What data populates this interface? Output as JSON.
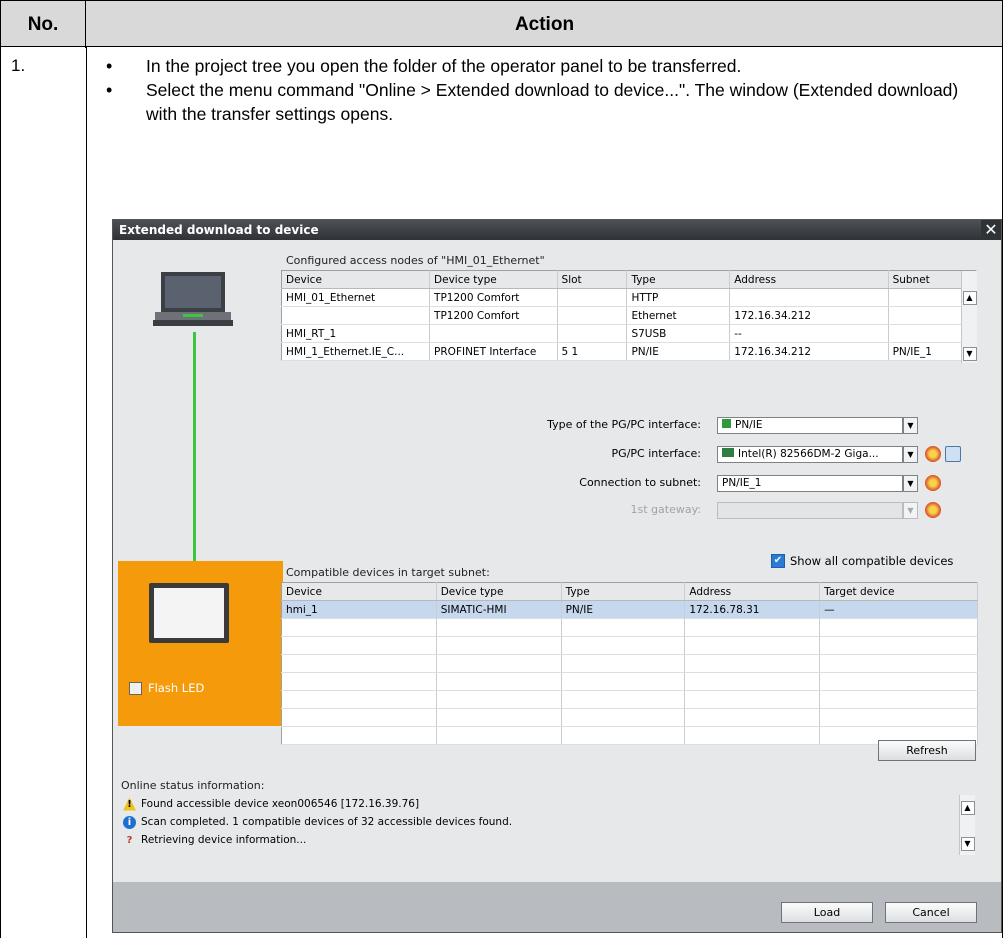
{
  "doc": {
    "col_no": "No.",
    "col_action": "Action",
    "step": "1.",
    "bullets": [
      "In the project tree you open the folder of the operator panel to be transferred.",
      "Select the menu command \"Online > Extended download to device...\". The window (Extended download) with the transfer settings opens."
    ]
  },
  "dialog": {
    "title": "Extended download to device",
    "close": "✕",
    "configured_caption": "Configured access nodes of \"HMI_01_Ethernet\"",
    "configured_headers": [
      "Device",
      "Device type",
      "Slot",
      "Type",
      "Address",
      "Subnet"
    ],
    "configured_rows": [
      [
        "HMI_01_Ethernet",
        "TP1200 Comfort",
        "",
        "HTTP",
        "",
        ""
      ],
      [
        "",
        "TP1200 Comfort",
        "",
        "Ethernet",
        "172.16.34.212",
        ""
      ],
      [
        "HMI_RT_1",
        "",
        "",
        "S7USB",
        "--",
        ""
      ],
      [
        "HMI_1_Ethernet.IE_C...",
        "PROFINET Interface",
        "5 1",
        "PN/IE",
        "172.16.34.212",
        "PN/IE_1"
      ]
    ],
    "labels": {
      "pgpc_type": "Type of the PG/PC interface:",
      "pgpc_interface": "PG/PC interface:",
      "subnet": "Connection to subnet:",
      "gateway": "1st gateway:"
    },
    "values": {
      "pgpc_type": "PN/IE",
      "pgpc_interface": "Intel(R) 82566DM-2 Giga...",
      "subnet": "PN/IE_1",
      "gateway": ""
    },
    "compatible_caption": "Compatible devices in target subnet:",
    "show_all_label": "Show all compatible devices",
    "compatible_headers": [
      "Device",
      "Device type",
      "Type",
      "Address",
      "Target device"
    ],
    "compatible_rows": [
      [
        "hmi_1",
        "SIMATIC-HMI",
        "PN/IE",
        "172.16.78.31",
        "—"
      ]
    ],
    "flash_led": "Flash LED",
    "refresh": "Refresh",
    "status_caption": "Online status information:",
    "status_items": [
      "Found accessible device xeon006546 [172.16.39.76]",
      "Scan completed. 1 compatible devices of 32 accessible devices found.",
      "Retrieving device information..."
    ],
    "load": "Load",
    "cancel": "Cancel"
  }
}
